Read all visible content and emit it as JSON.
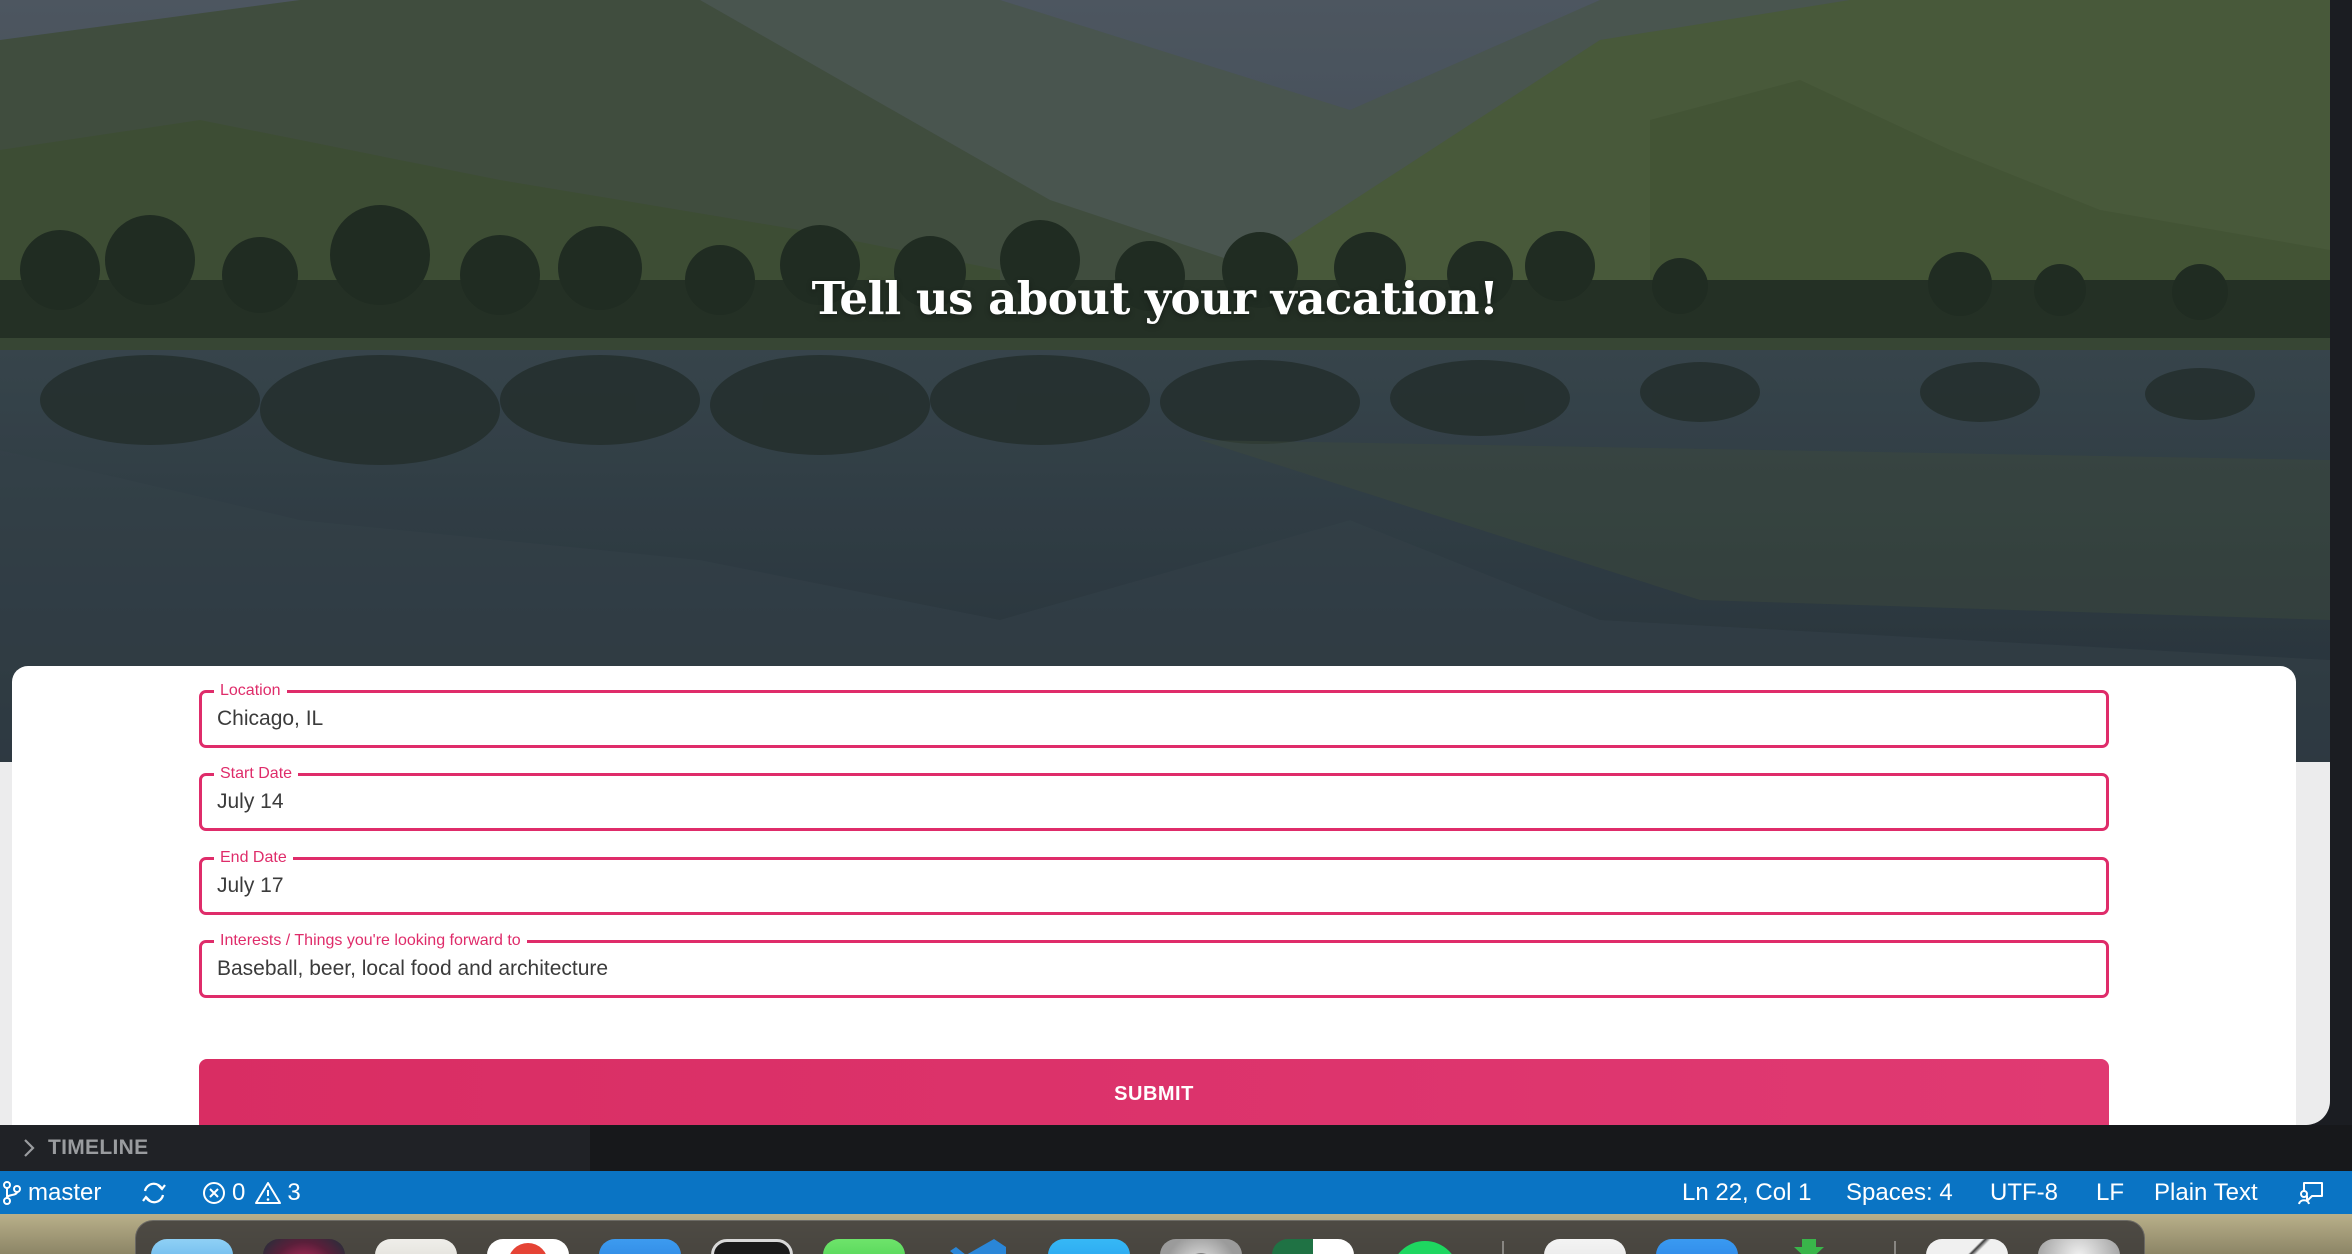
{
  "hero": {
    "title": "Tell us about your vacation!"
  },
  "form": {
    "fields": [
      {
        "label": "Location",
        "value": "Chicago, IL"
      },
      {
        "label": "Start Date",
        "value": "July 14"
      },
      {
        "label": "End Date",
        "value": "July 17"
      },
      {
        "label": "Interests / Things you're looking forward to",
        "value": "Baseball, beer, local food and architecture"
      }
    ],
    "submit_label": "SUBMIT",
    "accent_color": "#df2c6a"
  },
  "editor": {
    "timeline_label": "TIMELINE"
  },
  "statusbar": {
    "branch": "master",
    "errors": "0",
    "warnings": "3",
    "cursor": "Ln 22, Col 1",
    "indent": "Spaces: 4",
    "encoding": "UTF-8",
    "eol": "LF",
    "language": "Plain Text",
    "background_color": "#0a74c4",
    "icons": [
      "git-branch-icon",
      "sync-icon",
      "error-icon",
      "warning-icon",
      "feedback-icon"
    ]
  },
  "dock": {
    "icons": [
      "finder-icon",
      "siri-icon",
      "notes-icon",
      "chrome-icon",
      "files-icon",
      "terminal-icon",
      "messages-icon",
      "vscode-icon",
      "appstore-icon",
      "settings-icon",
      "excel-icon",
      "spotify-icon",
      "preview-icon",
      "mail-icon",
      "downloads-icon",
      "screenshot-icon",
      "trash-icon"
    ]
  }
}
